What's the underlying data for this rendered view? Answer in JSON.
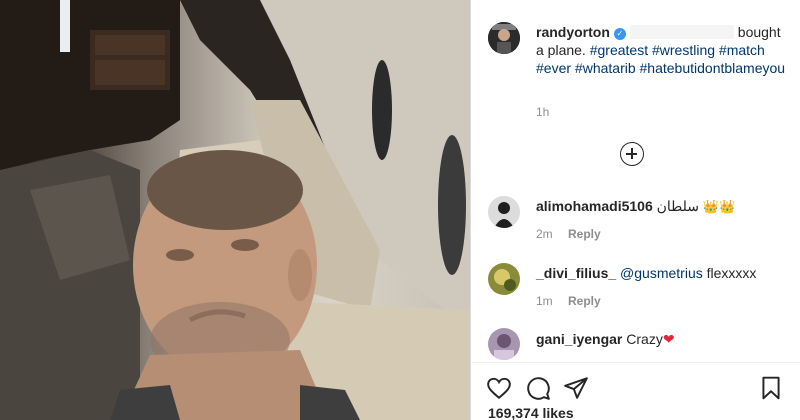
{
  "post": {
    "username": "randyorton",
    "verified_icon": "verified-badge-icon",
    "caption_text": "bought a plane.",
    "hashtags": [
      "#greatest",
      "#wrestling",
      "#match",
      "#ever",
      "#whatarib",
      "#hatebutidontblameyou"
    ],
    "time_ago": "1h",
    "likes": "169,374 likes"
  },
  "comments": [
    {
      "username": "alimohamadi5106",
      "text": "سلطان",
      "crown": "👑",
      "time": "2m",
      "reply": "Reply"
    },
    {
      "username": "_divi_filius_",
      "mention": "@gusmetrius",
      "text": "flexxxxx",
      "time": "1m",
      "reply": "Reply"
    },
    {
      "username": "gani_iyengar",
      "text": "Crazy",
      "heart": "❤"
    }
  ],
  "icons": {
    "more": "plus-circle-icon",
    "like": "heart-icon",
    "comment": "comment-icon",
    "share": "paper-plane-icon",
    "save": "bookmark-icon"
  },
  "colors": {
    "link": "#00376b",
    "verified": "#3897f0",
    "muted": "#8e8e8e",
    "text": "#262626"
  }
}
